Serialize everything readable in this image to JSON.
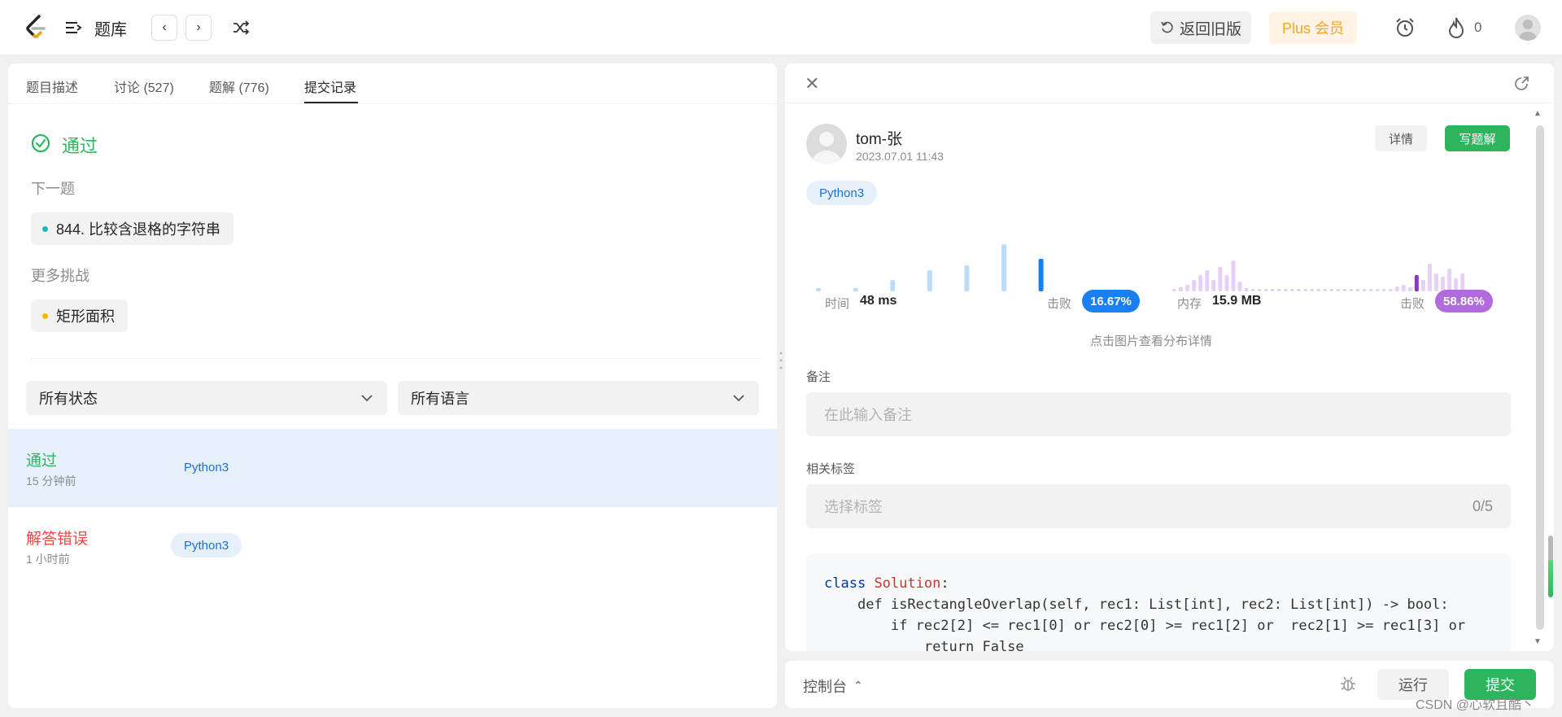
{
  "topbar": {
    "title": "题库",
    "old_version": "返回旧版",
    "plus": "Plus 会员",
    "fire_count": "0"
  },
  "left": {
    "tabs": [
      {
        "label": "题目描述"
      },
      {
        "label": "讨论 (527)"
      },
      {
        "label": "题解 (776)"
      },
      {
        "label": "提交记录"
      }
    ],
    "status": "通过",
    "next_label": "下一题",
    "next_problem": "844. 比较含退格的字符串",
    "more_label": "更多挑战",
    "more_problem": "矩形面积",
    "filter_status": "所有状态",
    "filter_language": "所有语言",
    "submissions": [
      {
        "status": "通过",
        "time": "15 分钟前",
        "lang": "Python3"
      },
      {
        "status": "解答错误",
        "time": "1 小时前",
        "lang": "Python3"
      }
    ]
  },
  "right": {
    "user_name": "tom-张",
    "date": "2023.07.01 11:43",
    "detail": "详情",
    "write_solution": "写题解",
    "language": "Python3",
    "time_label": "时间",
    "time_value": "48 ms",
    "beat_label": "击败",
    "time_beat": "16.67%",
    "memory_label": "内存",
    "memory_value": "15.9 MB",
    "memory_beat": "58.86%",
    "hint": "点击图片查看分布详情",
    "note_label": "备注",
    "note_placeholder": "在此输入备注",
    "tags_label": "相关标签",
    "tags_placeholder": "选择标签",
    "tags_count": "0/5",
    "code": {
      "line1_kw": "class",
      "line1_name": "Solution",
      "line2": "def isRectangleOverlap(self, rec1: List[int], rec2: List[int]) -> bool:",
      "line3": "if rec2[2] <= rec1[0] or rec2[0] >= rec1[2] or  rec2[1] >= rec1[3] or",
      "line4": "return False"
    },
    "time_dist": [
      4,
      0,
      4,
      0,
      14,
      0,
      26,
      0,
      32,
      0,
      58,
      0,
      40
    ],
    "memory_dist": [
      3,
      5,
      8,
      14,
      20,
      26,
      14,
      30,
      20,
      38,
      12,
      4,
      3,
      3,
      3,
      3,
      3,
      3,
      3,
      3,
      3,
      3,
      3,
      3,
      3,
      3,
      3,
      3,
      3,
      3,
      3,
      3,
      3,
      3,
      6,
      8,
      5,
      20,
      14,
      34,
      22,
      18,
      28,
      16,
      22
    ],
    "memory_highlight_index": 37
  },
  "bottom": {
    "console": "控制台",
    "run": "运行",
    "submit": "提交"
  },
  "watermark": "CSDN @心软且酷丶",
  "colors": {
    "accent_green": "#2db55d",
    "blue": "#1e88e5",
    "purple": "#b26bdc"
  }
}
